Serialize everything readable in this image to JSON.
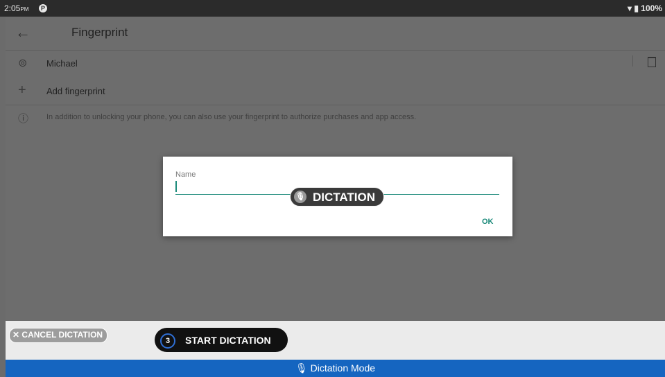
{
  "status_bar": {
    "time": "2:05",
    "ampm": "PM",
    "battery": "100%"
  },
  "app_bar": {
    "title": "Fingerprint"
  },
  "fingerprints": [
    {
      "name": "Michael"
    }
  ],
  "add_label": "Add fingerprint",
  "info_text": "In addition to unlocking your phone, you can also use your fingerprint to authorize purchases and app access.",
  "dialog": {
    "field_label": "Name",
    "field_value": "",
    "ok_label": "OK"
  },
  "dictation_overlay": {
    "label": "DICTATION"
  },
  "controls": {
    "cancel_label": "CANCEL DICTATION",
    "start_label": "START DICTATION",
    "countdown": "3"
  },
  "mode_bar": {
    "label": "Dictation Mode"
  },
  "colors": {
    "accent": "#1b8a7a",
    "mode_bar": "#1565c0"
  }
}
